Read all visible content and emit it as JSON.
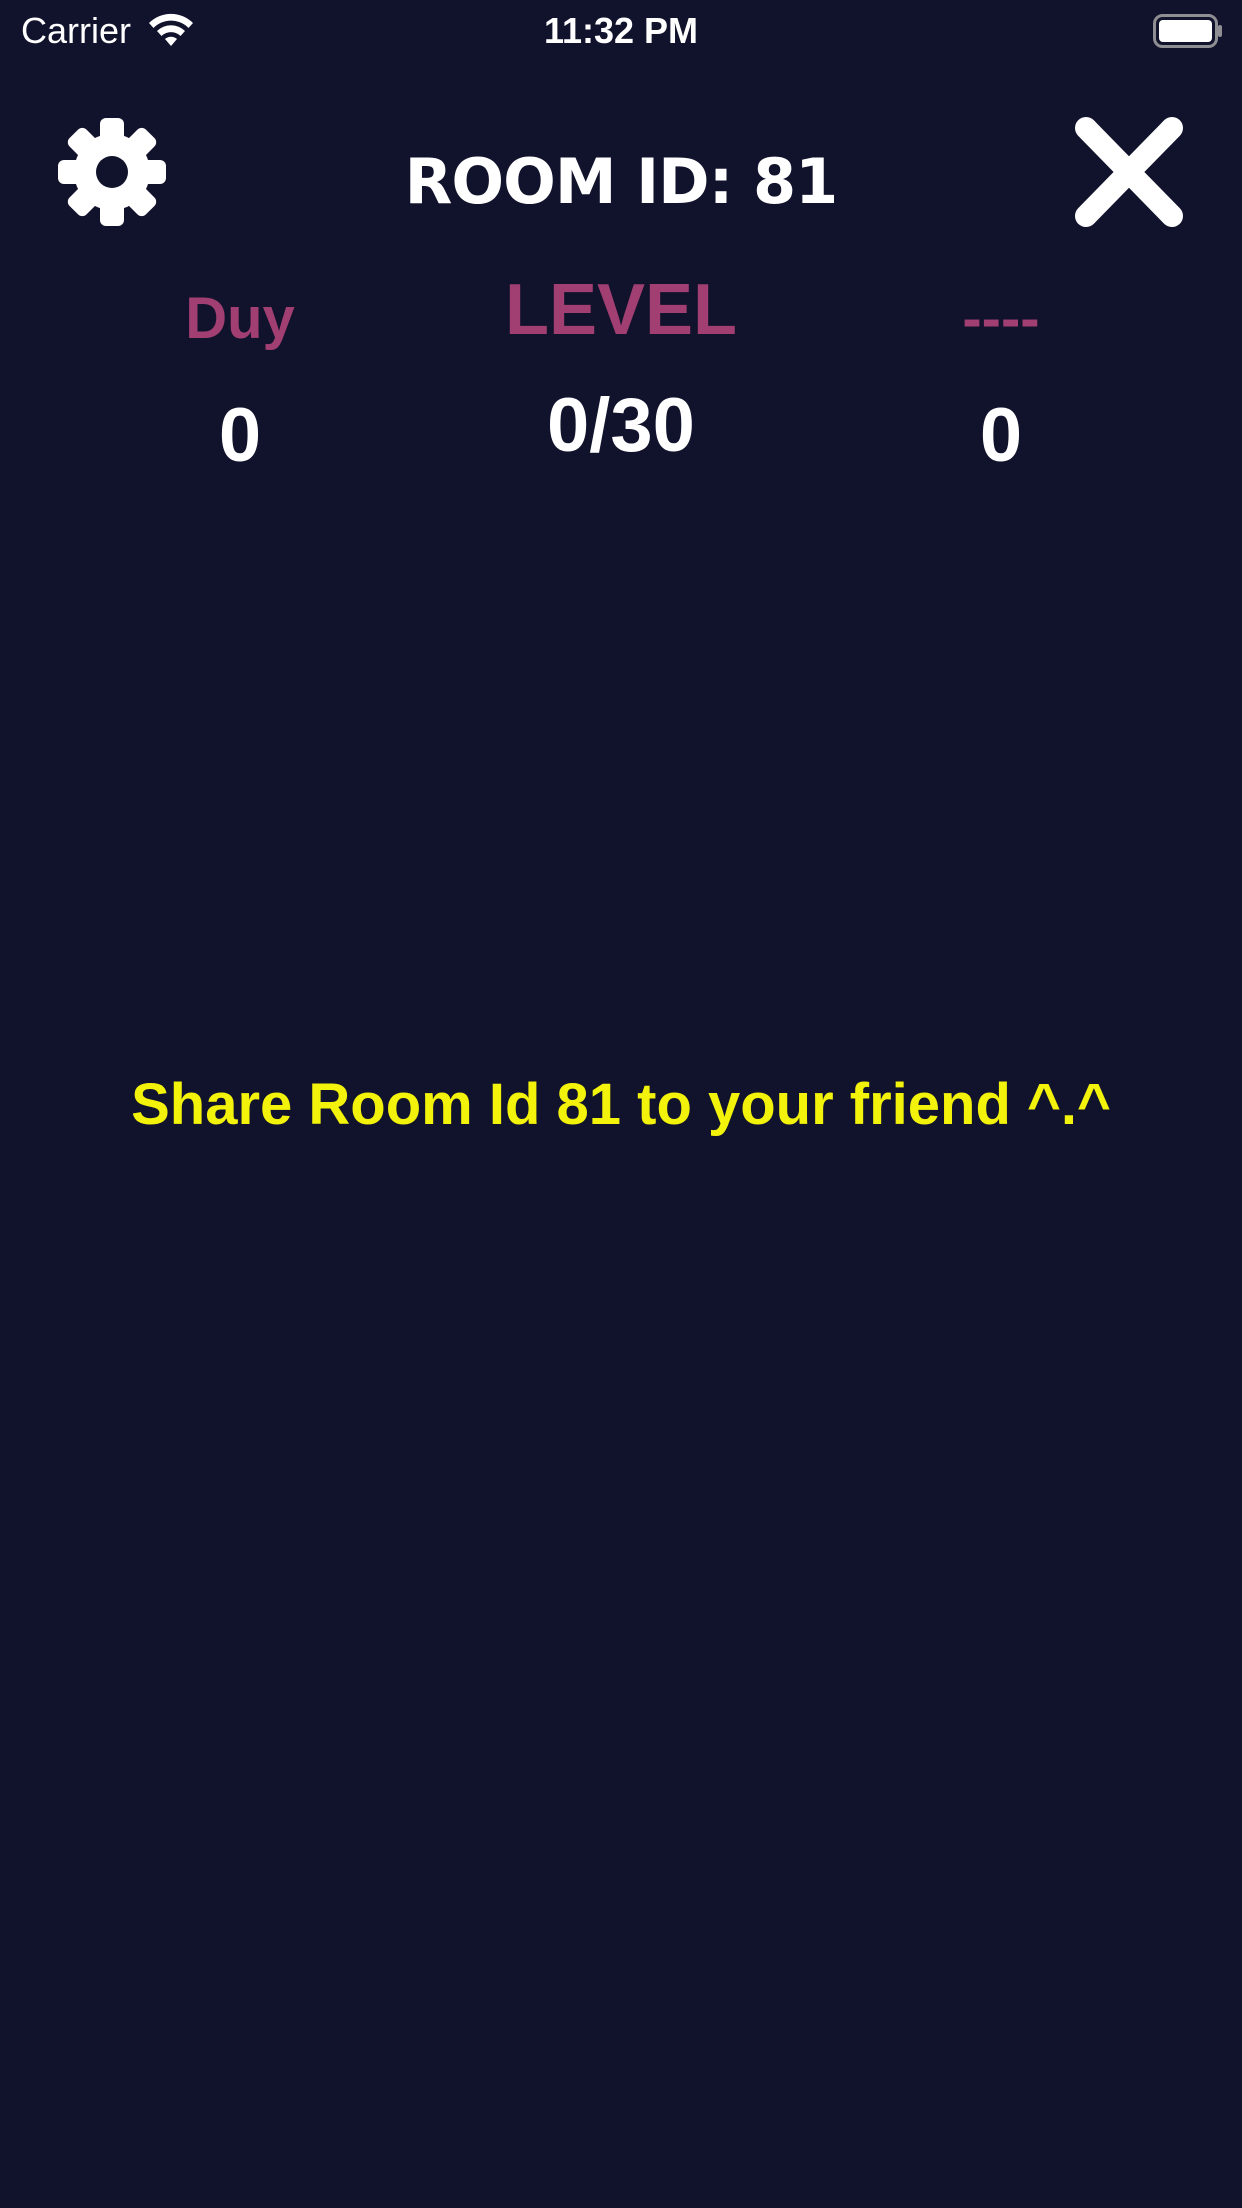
{
  "status_bar": {
    "carrier": "Carrier",
    "time": "11:32 PM",
    "wifi_icon": "wifi-icon",
    "battery_icon": "battery-icon"
  },
  "header": {
    "title": "ROOM ID: 81",
    "settings_icon": "gear-icon",
    "close_icon": "close-icon"
  },
  "scoreboard": {
    "player1": {
      "name": "Duy",
      "score": "0"
    },
    "level": {
      "label": "LEVEL",
      "value": "0/30"
    },
    "player2": {
      "name": "----",
      "score": "0"
    }
  },
  "message": "Share Room Id 81 to your friend ^.^",
  "colors": {
    "background": "#11122c",
    "accent_pink": "#a13f72",
    "message_yellow": "#f2f20a",
    "text_white": "#ffffff"
  }
}
